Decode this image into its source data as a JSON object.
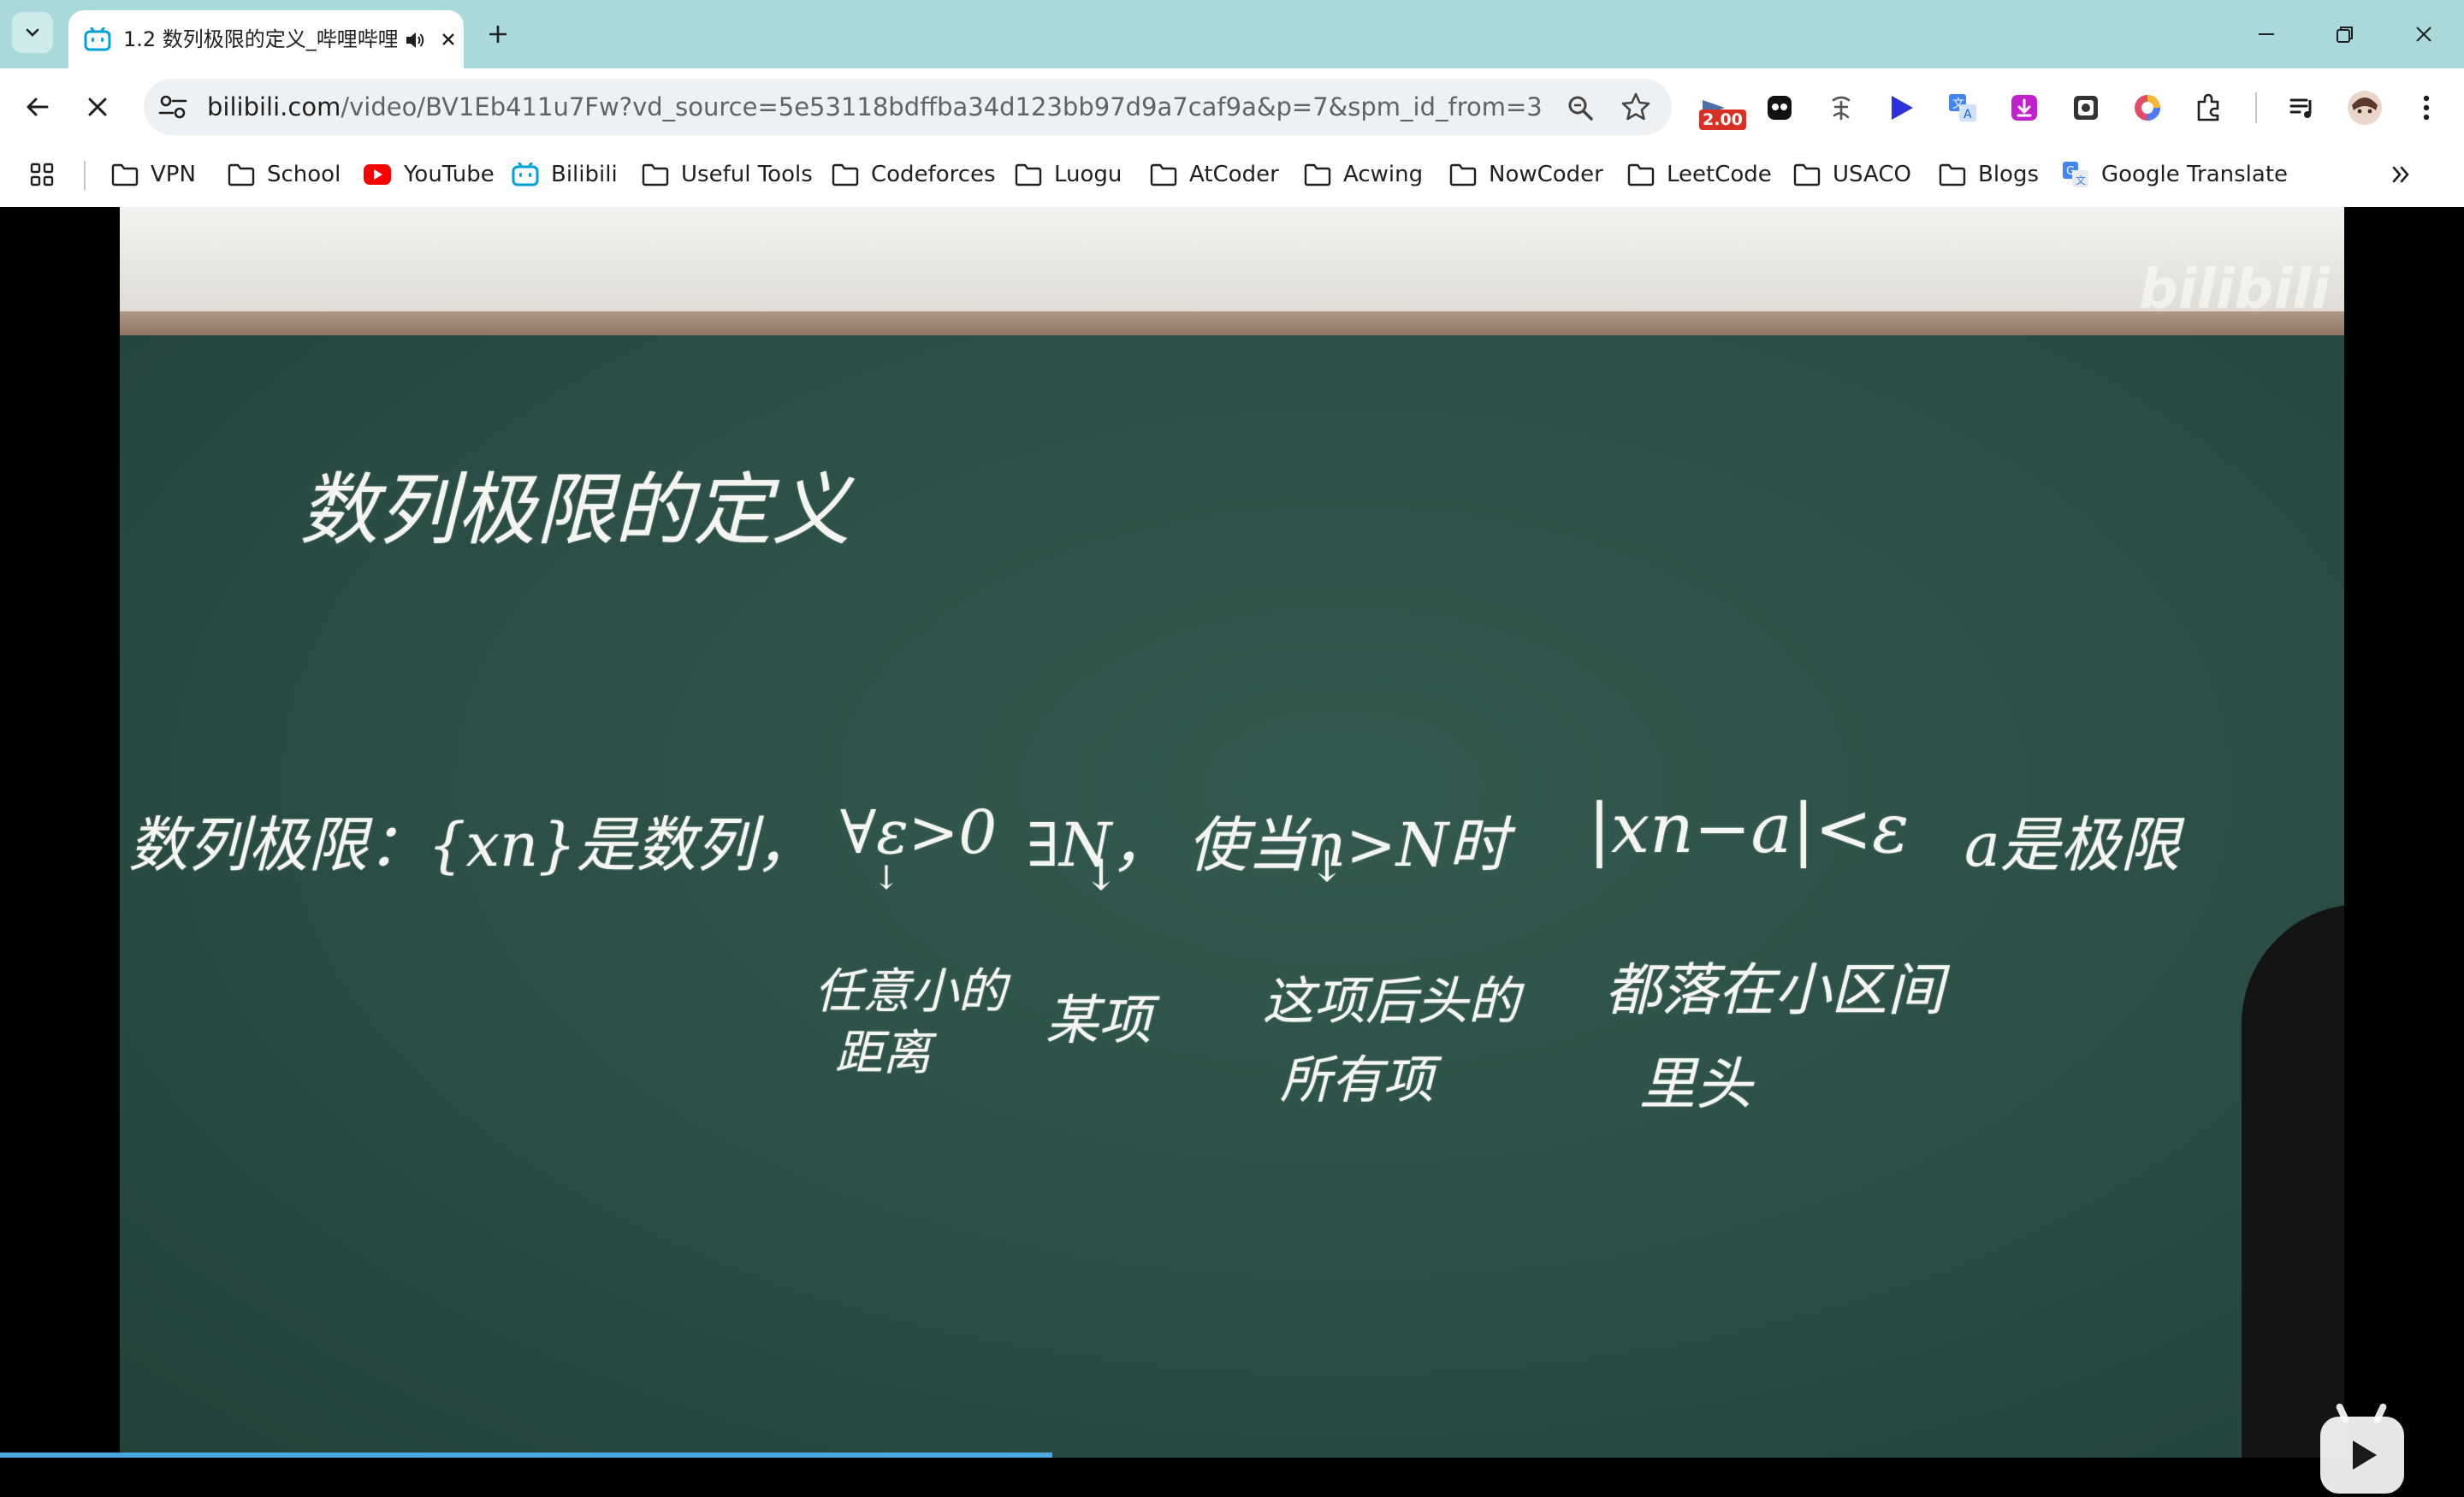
{
  "tab": {
    "title": "1.2 数列极限的定义_哔哩哔哩",
    "close_glyph": "✕"
  },
  "toolbar": {
    "url_host": "bilibili.com",
    "url_path": "/video/BV1Eb411u7Fw?vd_source=5e53118bdffba34d123bb97d9a7caf9a&p=7&spm_id_from=333.788....",
    "ext_badge": "2.00"
  },
  "bookmarks": [
    {
      "label": "VPN",
      "icon": "folder-icon"
    },
    {
      "label": "School",
      "icon": "folder-icon"
    },
    {
      "label": "YouTube",
      "icon": "youtube-icon"
    },
    {
      "label": "Bilibili",
      "icon": "bilibili-icon"
    },
    {
      "label": "Useful Tools",
      "icon": "folder-icon"
    },
    {
      "label": "Codeforces",
      "icon": "folder-icon"
    },
    {
      "label": "Luogu",
      "icon": "folder-icon"
    },
    {
      "label": "AtCoder",
      "icon": "folder-icon"
    },
    {
      "label": "Acwing",
      "icon": "folder-icon"
    },
    {
      "label": "NowCoder",
      "icon": "folder-icon"
    },
    {
      "label": "LeetCode",
      "icon": "folder-icon"
    },
    {
      "label": "USACO",
      "icon": "folder-icon"
    },
    {
      "label": "Blogs",
      "icon": "folder-icon"
    },
    {
      "label": "Google Translate",
      "icon": "google-translate-icon"
    }
  ],
  "video": {
    "watermark": "bilibili",
    "board": {
      "title": "数列极限的定义",
      "line1": [
        "数列极限：{xn}是数列，",
        "∀ε>0",
        "∃N，",
        "使当n>N时",
        "|xn−a|<ε",
        "a是极限"
      ],
      "under_eps": [
        "任意小的",
        "距离"
      ],
      "under_N": [
        "某项"
      ],
      "under_n": [
        "这项后头的",
        "所有项"
      ],
      "under_abs": [
        "都落在小区间",
        "里头"
      ]
    }
  }
}
